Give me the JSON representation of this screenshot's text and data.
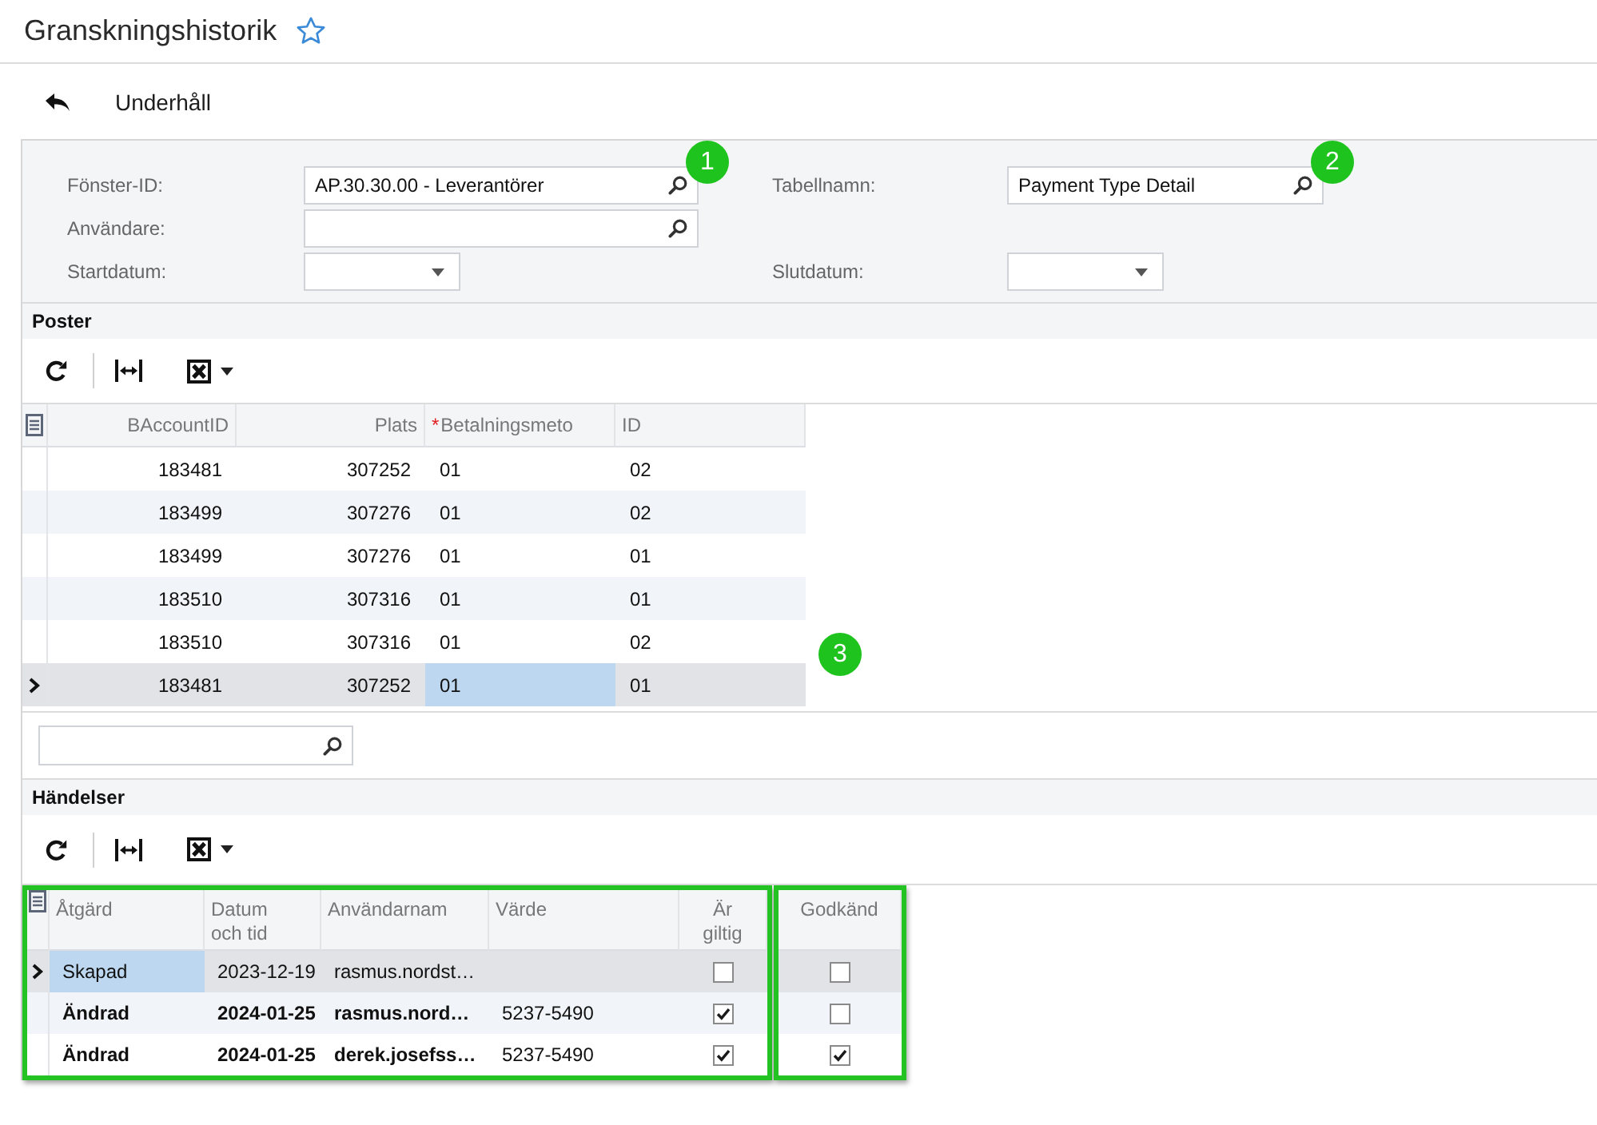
{
  "page": {
    "title": "Granskningshistorik",
    "starred": false
  },
  "toolbar": {
    "label": "Underhåll"
  },
  "filters": {
    "rows": [
      [
        {
          "label": "Fönster-ID:",
          "kind": "lookup",
          "value": "AP.30.30.00 - Leverantörer",
          "badge": "1"
        },
        {
          "label": "Tabellnamn:",
          "kind": "lookup",
          "value": "Payment Type Detail",
          "badge": "2"
        }
      ],
      [
        {
          "label": "Användare:",
          "kind": "lookup"
        }
      ],
      [
        {
          "label": "Startdatum:",
          "kind": "date"
        },
        {
          "label": "Slutdatum:",
          "kind": "date"
        }
      ]
    ]
  },
  "records": {
    "title": "Poster",
    "badge": "3",
    "table": {
      "columns": [
        {
          "label": "BAccountID",
          "kind": "number"
        },
        {
          "label": "Plats",
          "kind": "number"
        },
        {
          "label": "Betalningsmeto",
          "kind": "text",
          "marker": "*"
        },
        {
          "label": "ID",
          "kind": "text"
        }
      ],
      "rows": [
        {
          "selected": false,
          "cells": [
            {
              "text": "183481",
              "active": false
            },
            {
              "text": "307252",
              "active": false
            },
            {
              "text": "01",
              "active": false
            },
            {
              "text": "02",
              "active": false
            }
          ]
        },
        {
          "selected": false,
          "cells": [
            {
              "text": "183499",
              "active": false
            },
            {
              "text": "307276",
              "active": false
            },
            {
              "text": "01",
              "active": false
            },
            {
              "text": "02",
              "active": false
            }
          ]
        },
        {
          "selected": false,
          "cells": [
            {
              "text": "183499",
              "active": false
            },
            {
              "text": "307276",
              "active": false
            },
            {
              "text": "01",
              "active": false
            },
            {
              "text": "01",
              "active": false
            }
          ]
        },
        {
          "selected": false,
          "cells": [
            {
              "text": "183510",
              "active": false
            },
            {
              "text": "307316",
              "active": false
            },
            {
              "text": "01",
              "active": false
            },
            {
              "text": "01",
              "active": false
            }
          ]
        },
        {
          "selected": false,
          "cells": [
            {
              "text": "183510",
              "active": false
            },
            {
              "text": "307316",
              "active": false
            },
            {
              "text": "01",
              "active": false
            },
            {
              "text": "02",
              "active": false
            }
          ]
        },
        {
          "selected": true,
          "cells": [
            {
              "text": "183481",
              "active": false
            },
            {
              "text": "307252",
              "active": false
            },
            {
              "text": "01",
              "active": true
            },
            {
              "text": "01",
              "active": false
            }
          ]
        }
      ]
    }
  },
  "events": {
    "title": "Händelser",
    "table": {
      "column_groups": [
        {
          "framed": true,
          "columns": [
            {
              "label": "Åtgärd",
              "kind": "text"
            },
            {
              "label": "Datum\noch tid",
              "kind": "text"
            },
            {
              "label": "Användarnam",
              "kind": "text"
            },
            {
              "label": "Värde",
              "kind": "text"
            },
            {
              "label": "Är\ngiltig",
              "kind": "check"
            }
          ]
        },
        {
          "framed": true,
          "columns": [
            {
              "label": "Godkänd",
              "kind": "check"
            }
          ]
        }
      ],
      "rows": [
        {
          "selected": true,
          "cells": [
            {
              "text": "Skapad",
              "bold": false,
              "active": true
            },
            {
              "text": "2023-12-19",
              "bold": false,
              "active": false
            },
            {
              "text": "rasmus.nordst…",
              "bold": false,
              "active": false
            },
            {
              "active": false
            },
            {
              "checked": false,
              "active": false
            },
            {
              "checked": false,
              "active": false
            }
          ]
        },
        {
          "selected": false,
          "cells": [
            {
              "text": "Ändrad",
              "bold": true,
              "active": false
            },
            {
              "text": "2024-01-25",
              "bold": true,
              "active": false
            },
            {
              "text": "rasmus.nord…",
              "bold": true,
              "active": false
            },
            {
              "text": "5237-5490",
              "bold": false,
              "active": false
            },
            {
              "checked": true,
              "active": false
            },
            {
              "checked": false,
              "active": false
            }
          ]
        },
        {
          "selected": false,
          "cells": [
            {
              "text": "Ändrad",
              "bold": true,
              "active": false
            },
            {
              "text": "2024-01-25",
              "bold": true,
              "active": false
            },
            {
              "text": "derek.josefss…",
              "bold": true,
              "active": false
            },
            {
              "text": "5237-5490",
              "bold": false,
              "active": false
            },
            {
              "checked": true,
              "active": false
            },
            {
              "checked": true,
              "active": false
            }
          ]
        }
      ]
    }
  }
}
